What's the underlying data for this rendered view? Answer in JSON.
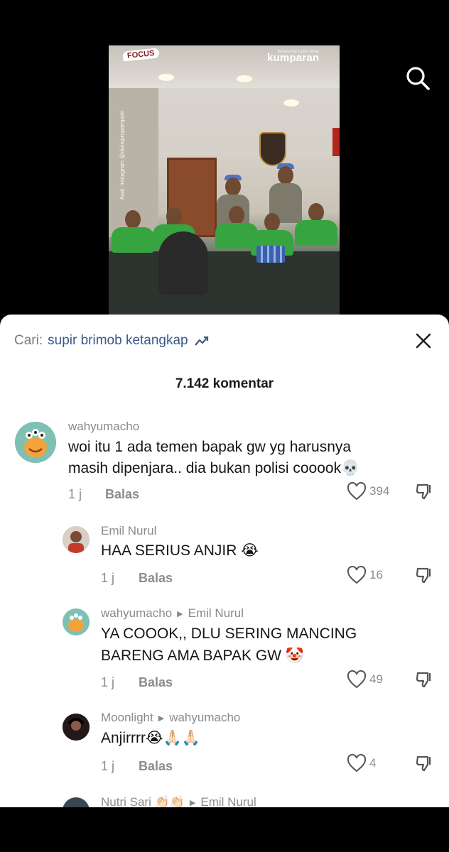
{
  "video": {
    "badge": "FOCUS",
    "watermark": "kumparan",
    "watermark_tagline": "Beyond the Latest News",
    "credit": "Asal: Instagram @divisipropampolri"
  },
  "search_bar": {
    "prefix": "Cari:",
    "query": "supir brimob ketangkap"
  },
  "comment_count": "7.142 komentar",
  "comments": [
    {
      "username": "wahyumacho",
      "line1": "woi itu 1 ada temen bapak gw yg harusnya",
      "line2": "masih dipenjara.. dia bukan polisi cooook💀",
      "time": "1 j",
      "reply": "Balas",
      "likes": "394"
    },
    {
      "username": "Emil Nurul",
      "line1": "HAA SERIUS ANJIR 😭",
      "time": "1 j",
      "reply": "Balas",
      "likes": "16"
    },
    {
      "username": "wahyumacho",
      "reply_to": "Emil Nurul",
      "line1": "YA COOOK,, DLU SERING MANCING",
      "line2": "BARENG AMA BAPAK GW 🤡",
      "time": "1 j",
      "reply": "Balas",
      "likes": "49"
    },
    {
      "username": "Moonlight",
      "reply_to": "wahyumacho",
      "line1": "Anjirrrr😭🙏🏻🙏🏻",
      "time": "1 j",
      "reply": "Balas",
      "likes": "4"
    },
    {
      "username": "Nutri Sari 👏🏻👏🏻",
      "reply_to": "Emil Nurul"
    }
  ],
  "icons": {
    "search": "search-icon",
    "close": "close-icon",
    "trend": "trending-icon",
    "like": "heart-icon",
    "dislike": "thumbs-down-icon"
  }
}
